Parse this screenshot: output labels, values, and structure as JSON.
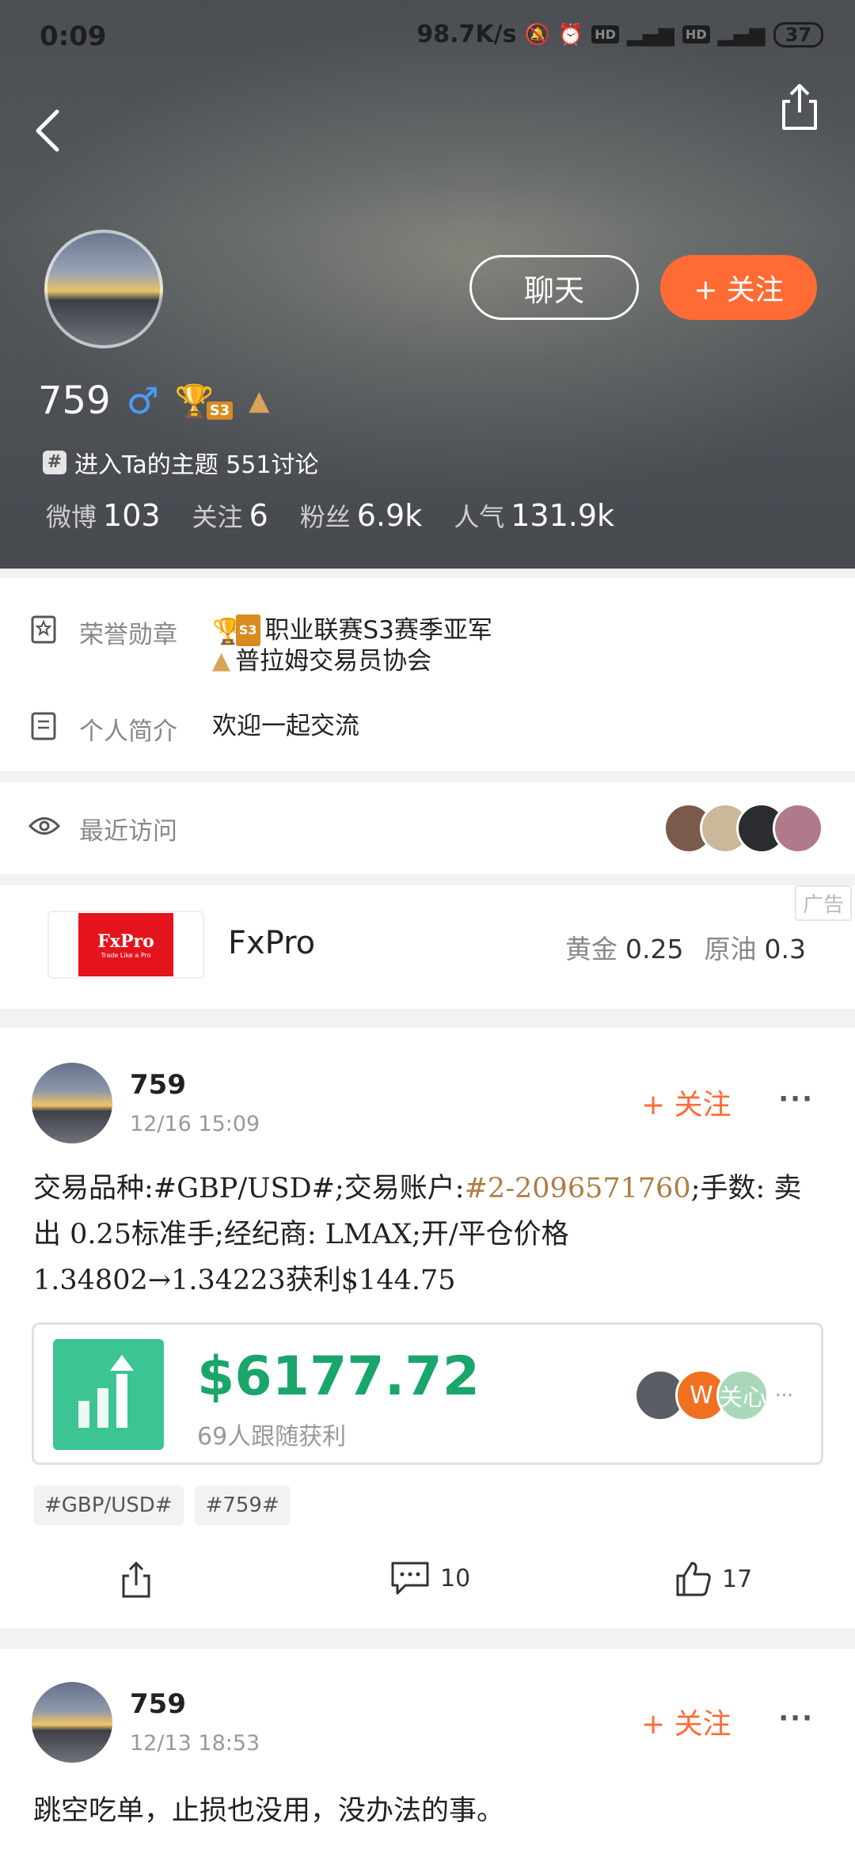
{
  "status_bar": {
    "time": "0:09",
    "network_speed": "98.7K/s",
    "battery": "37"
  },
  "profile": {
    "username": "759",
    "gender_symbol": "♂",
    "badge_s3": "S3",
    "topic_text": "进入Ta的主题 551讨论",
    "chat_label": "聊天",
    "follow_label": "+ 关注",
    "stats": [
      {
        "label": "微博",
        "value": "103"
      },
      {
        "label": "关注",
        "value": "6"
      },
      {
        "label": "粉丝",
        "value": "6.9k"
      },
      {
        "label": "人气",
        "value": "131.9k"
      }
    ]
  },
  "info": {
    "honor_label": "荣誉勋章",
    "honor_medal_1": "职业联赛S3赛季亚军",
    "honor_medal_2": "普拉姆交易员协会",
    "intro_label": "个人简介",
    "intro_value": "欢迎一起交流"
  },
  "visitors": {
    "label": "最近访问",
    "avatar_colors": [
      "#7a5a4a",
      "#c9b89a",
      "#2a2c30",
      "#b07a8a"
    ]
  },
  "ad": {
    "logo_main": "FxPro",
    "logo_sub": "Trade Like a Pro",
    "name": "FxPro",
    "tag": "广告",
    "quote1_label": "黄金",
    "quote1_value": "0.25",
    "quote2_label": "原油",
    "quote2_value": "0.3"
  },
  "posts": [
    {
      "username": "759",
      "time": "12/16 15:09",
      "follow_label": "+ 关注",
      "more": "···",
      "text_line1_a": "交易品种:#GBP/USD#;交易账户:",
      "text_line1_link": "#2-2096571760",
      "text_line1_b": ";手数: 卖",
      "text_line2": "出 0.25标准手;经纪商: LMAX;开/平仓价格",
      "text_line3": "1.34802→1.34223获利$144.75",
      "profit_amount": "$6177.72",
      "profit_desc": "69人跟随获利",
      "follower_avatars": [
        {
          "text": "",
          "color": "#5a5e64"
        },
        {
          "text": "W",
          "color": "#f07020"
        },
        {
          "text": "关心",
          "color": "#a8d8b8"
        }
      ],
      "follower_more": "···",
      "hashtags": [
        "#GBP/USD#",
        "#759#"
      ],
      "comments": "10",
      "likes": "17"
    },
    {
      "username": "759",
      "time": "12/13 18:53",
      "follow_label": "+ 关注",
      "more": "···",
      "text": "跳空吃单，止损也没用，没办法的事。"
    }
  ],
  "colors": {
    "accent": "#ff6b35",
    "profit_green": "#1aa56a",
    "link_brown": "#b07c44"
  }
}
